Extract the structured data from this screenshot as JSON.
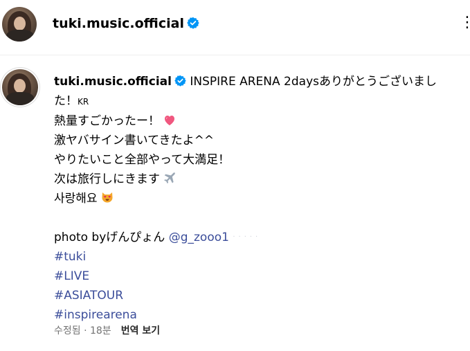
{
  "header": {
    "username": "tuki.music.official"
  },
  "post": {
    "username": "tuki.music.official",
    "line1_text": "INSPIRE ARENA 2daysありがとうございまし",
    "line2_text": "た！",
    "line2_tag": "KR",
    "line3": "熱量すごかったー！",
    "line4": "激ヤバサイン書いてきたよ^^",
    "line5": "やりたいこと全部やって大満足！",
    "line6": "次は旅行しにきます",
    "line7": "사랑해요",
    "photo_by": "photo byげんぴょん",
    "photo_mention": "@g_zooo1",
    "hashtags": [
      "#tuki",
      "#LIVE",
      "#ASIATOUR",
      "#inspirearena"
    ]
  },
  "footer": {
    "meta": "수정됨 · 18분",
    "translate": "번역 보기"
  },
  "colors": {
    "verified_badge": "#0095f6",
    "link": "#3b4d9a",
    "muted": "#737373"
  },
  "icons": [
    "verified-badge-icon",
    "heart-emoji-icon",
    "airplane-emoji-icon",
    "heart-eyes-cat-emoji-icon",
    "more-options-icon"
  ]
}
